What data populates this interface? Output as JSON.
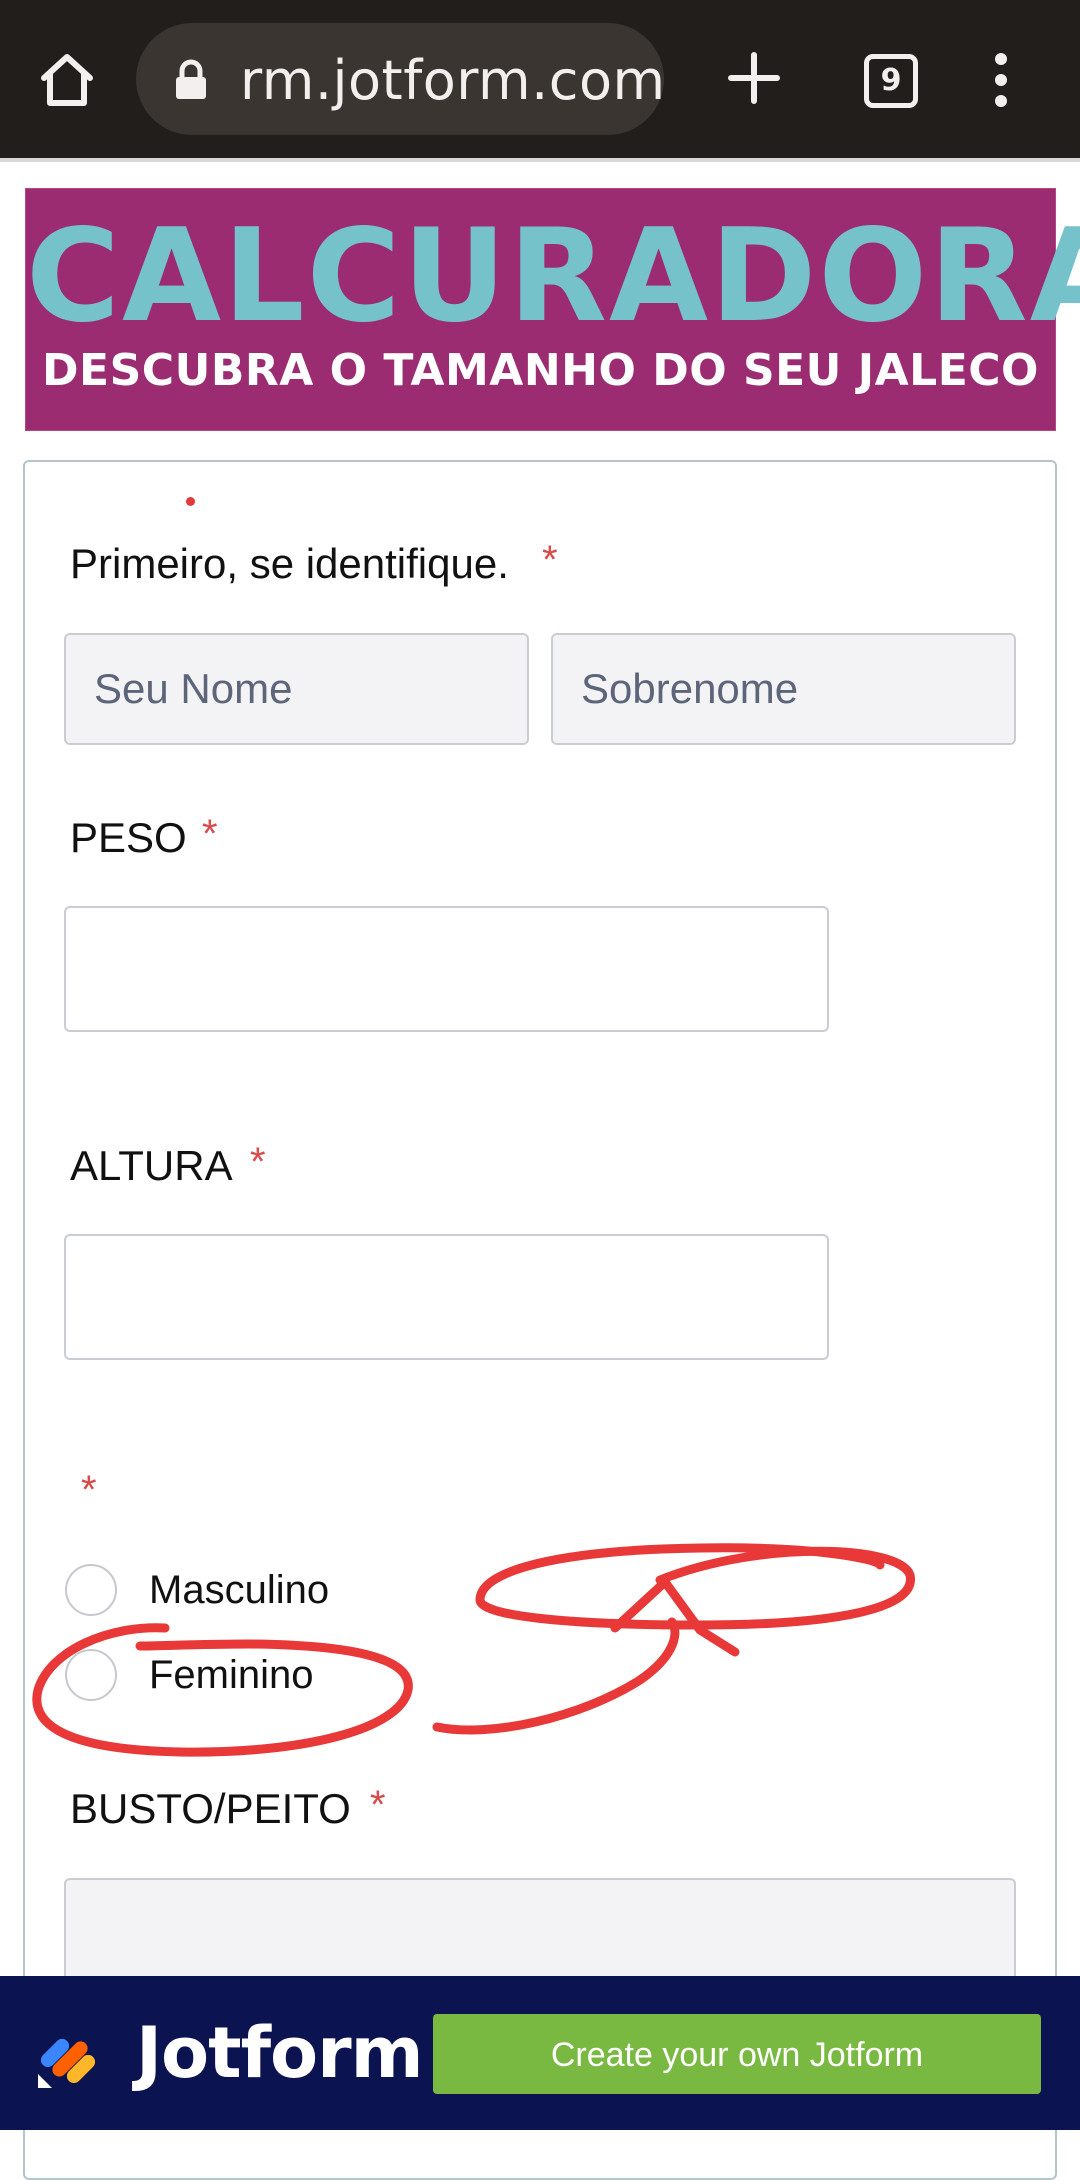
{
  "browser": {
    "url": "rm.jotform.com",
    "tab_count": "9"
  },
  "banner": {
    "title": "CALCURADORA",
    "subtitle": "DESCUBRA O TAMANHO DO SEU JALECO"
  },
  "form": {
    "name_section": {
      "label": "Primeiro, se identifique.",
      "required_mark": "*",
      "first_name_placeholder": "Seu Nome",
      "last_name_placeholder": "Sobrenome"
    },
    "weight": {
      "label": "PESO",
      "required_mark": "*",
      "value": ""
    },
    "height": {
      "label": "ALTURA",
      "required_mark": "*",
      "value": ""
    },
    "gender": {
      "required_mark": "*",
      "options": [
        "Masculino",
        "Feminino"
      ]
    },
    "bust": {
      "label": "BUSTO/PEITO",
      "required_mark": "*"
    }
  },
  "footer": {
    "brand": "Jotform",
    "cta_label": "Create your own Jotform"
  },
  "colors": {
    "banner_bg": "#9c2c71",
    "banner_title": "#75c2cb",
    "required": "#d94a4a",
    "cta_bg": "#7ab941",
    "footer_bg": "#0b1350",
    "annotation": "#e83838"
  },
  "icons": [
    "home-icon",
    "lock-icon",
    "new-tab-icon",
    "tabs-icon",
    "more-vert-icon",
    "jotform-logo-icon"
  ]
}
